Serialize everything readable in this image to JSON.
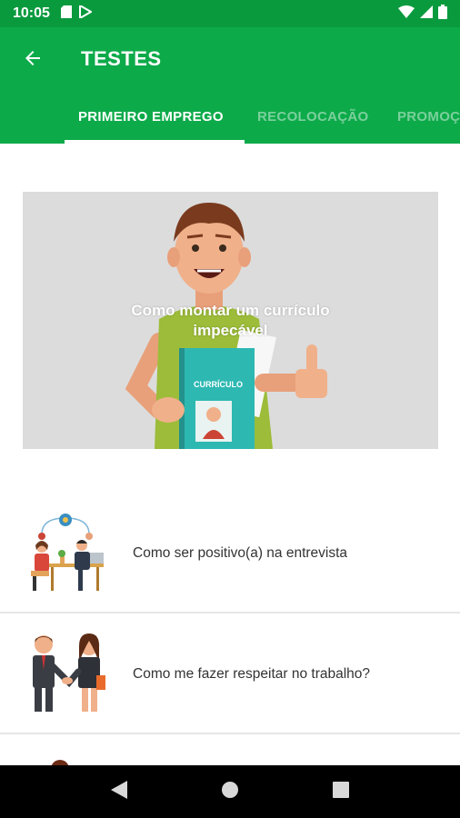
{
  "status_bar": {
    "time": "10:05"
  },
  "app_bar": {
    "title": "TESTES"
  },
  "tabs": [
    {
      "label": "PRIMEIRO EMPREGO",
      "active": true
    },
    {
      "label": "RECOLOCAÇÃO",
      "active": false
    },
    {
      "label": "PROMOÇ",
      "active": false
    }
  ],
  "featured": {
    "caption": "Como montar um currículo impecável",
    "badge": "CURRÍCULO"
  },
  "list": [
    {
      "label": "Como ser positivo(a) na entrevista",
      "icon": "interview-illustration"
    },
    {
      "label": "Como me fazer respeitar no trabalho?",
      "icon": "handshake-illustration"
    }
  ],
  "colors": {
    "status_bar": "#0a9a3e",
    "app_bar": "#0daa4a",
    "accent": "#ffffff"
  }
}
